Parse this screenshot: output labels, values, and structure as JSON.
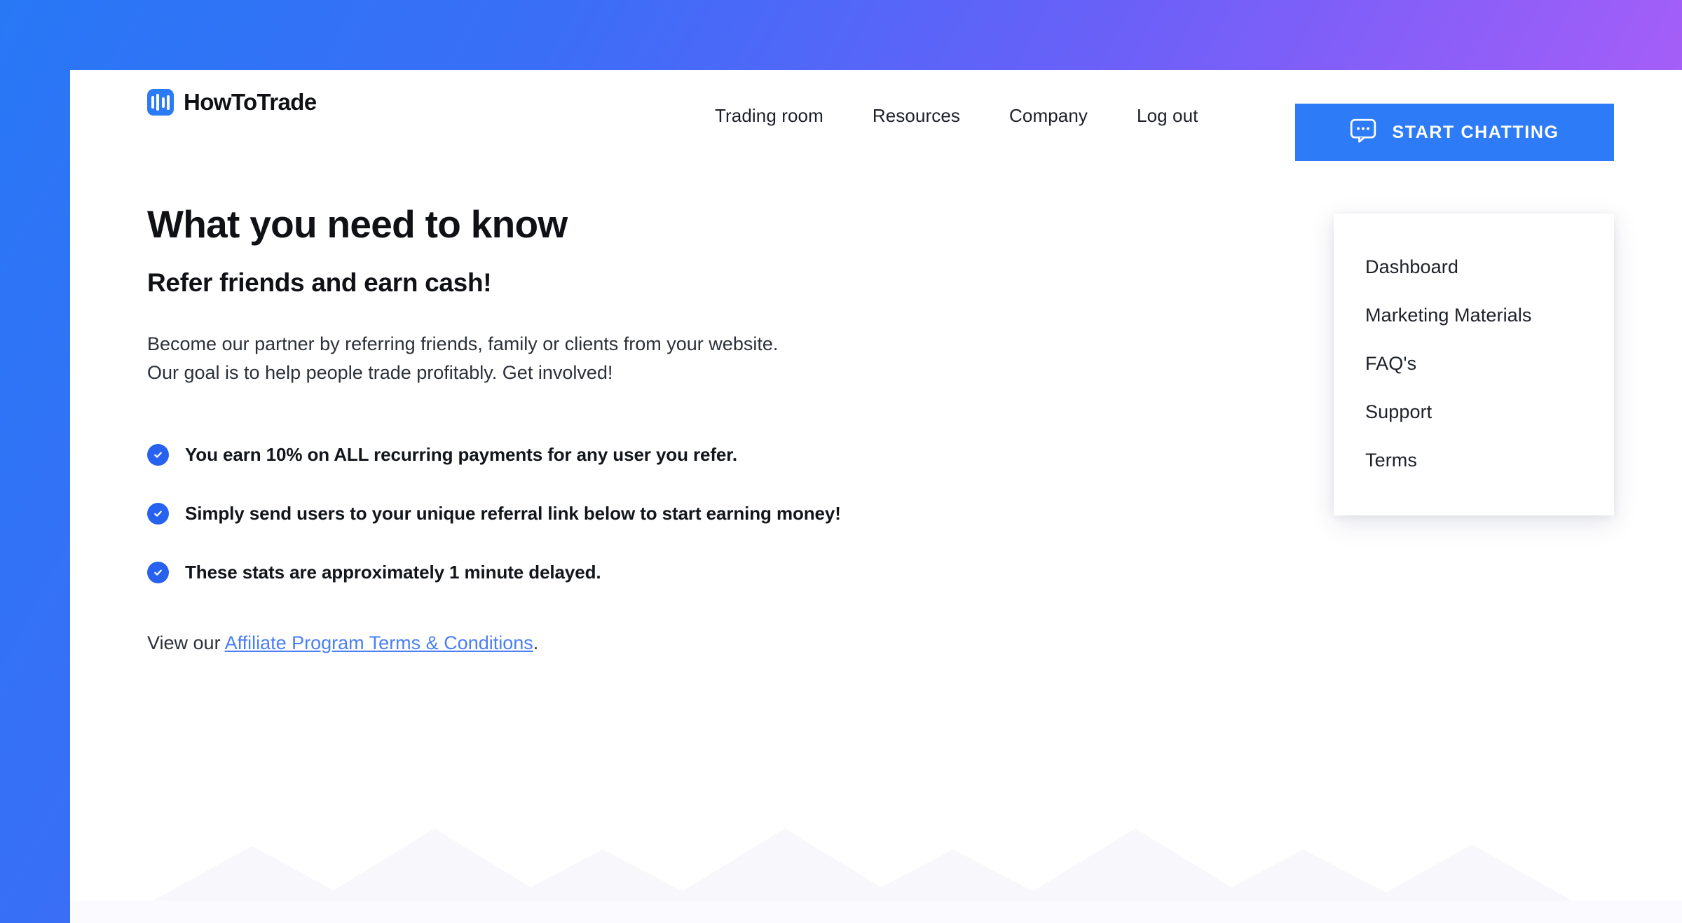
{
  "theme": {
    "gradient_start": "#2878f6",
    "gradient_end": "#cf5df4",
    "accent_blue": "#2d7bf7",
    "check_blue": "#2761f0",
    "link_blue": "#4a7ff5",
    "text_dark": "#0f1115"
  },
  "header": {
    "logo_text": "HowToTrade",
    "logo_icon": "bar-chart-icon",
    "nav": [
      {
        "label": "Trading room"
      },
      {
        "label": "Resources"
      },
      {
        "label": "Company"
      },
      {
        "label": "Log out"
      }
    ],
    "chat_button": {
      "label": "START CHATTING",
      "icon": "chat-bubble-icon"
    }
  },
  "dropdown": {
    "items": [
      {
        "label": "Dashboard"
      },
      {
        "label": "Marketing Materials"
      },
      {
        "label": "FAQ's"
      },
      {
        "label": "Support"
      },
      {
        "label": "Terms"
      }
    ]
  },
  "main": {
    "title": "What you need to know",
    "subtitle": "Refer friends and earn cash!",
    "intro_line_1": "Become our partner by referring friends, family or clients from your website.",
    "intro_line_2": "Our goal is to help people trade profitably. Get involved!",
    "bullets": [
      {
        "icon": "check-circle-icon",
        "text": "You earn 10% on ALL recurring payments for any user you refer."
      },
      {
        "icon": "check-circle-icon",
        "text": "Simply send users to your unique referral link below to start earning money!"
      },
      {
        "icon": "check-circle-icon",
        "text": "These stats are approximately 1 minute delayed."
      }
    ],
    "footer_prefix": "View our ",
    "footer_link": "Affiliate Program Terms & Conditions",
    "footer_suffix": "."
  }
}
